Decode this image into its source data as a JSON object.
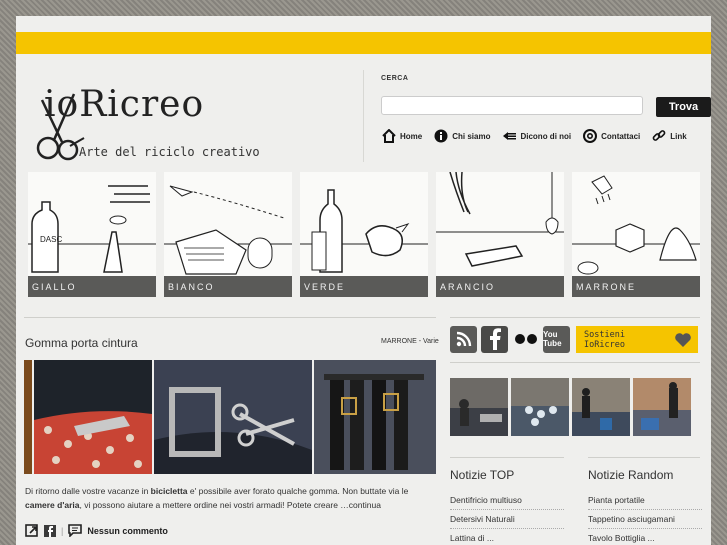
{
  "brand": {
    "logo_text": "ioRicreo",
    "tagline": "Arte del riciclo creativo"
  },
  "search": {
    "label": "CERCA",
    "placeholder": "",
    "button_label": "Trova"
  },
  "nav": {
    "items": [
      {
        "label": "Home",
        "icon": "home-icon"
      },
      {
        "label": "Chi siamo",
        "icon": "info-icon"
      },
      {
        "label": "Dicono di noi",
        "icon": "arrow-left-icon"
      },
      {
        "label": "Contattaci",
        "icon": "at-icon"
      },
      {
        "label": "Link",
        "icon": "link-icon"
      }
    ]
  },
  "categories": [
    {
      "label": "GIALLO"
    },
    {
      "label": "BIANCO"
    },
    {
      "label": "VERDE"
    },
    {
      "label": "ARANCIO"
    },
    {
      "label": "MARRONE"
    }
  ],
  "post": {
    "title": "Gomma porta cintura",
    "category": "MARRONE - Varie",
    "text_1": "Di ritorno dalle vostre vacanze in ",
    "text_bold_1": "bicicletta",
    "text_2": " e' possibile aver forato qualche gomma. Non buttate via le ",
    "text_bold_2": "camere d'aria",
    "text_3": ", vi possono aiutare a mettere ordine nei vostri armadi! Potete creare …",
    "continue_label": "continua",
    "comments_label": "Nessun commento"
  },
  "sidebar": {
    "social": [
      {
        "icon": "rss-icon"
      },
      {
        "icon": "facebook-icon"
      },
      {
        "icon": "flickr-icon"
      },
      {
        "icon": "youtube-icon",
        "label": "You Tube"
      }
    ],
    "support_line1": "Sostieni",
    "support_line2": "IoRicreo",
    "top_news": {
      "title": "Notizie TOP",
      "items": [
        "Dentifricio multiuso",
        "Detersivi Naturali",
        "Lattina di ..."
      ]
    },
    "random_news": {
      "title": "Notizie Random",
      "items": [
        "Pianta portatile",
        "Tappetino asciugamani",
        "Tavolo Bottiglia ..."
      ]
    }
  },
  "colors": {
    "accent_yellow": "#f5c400",
    "label_bar": "#5a5a58",
    "page_bg": "#efefed"
  }
}
